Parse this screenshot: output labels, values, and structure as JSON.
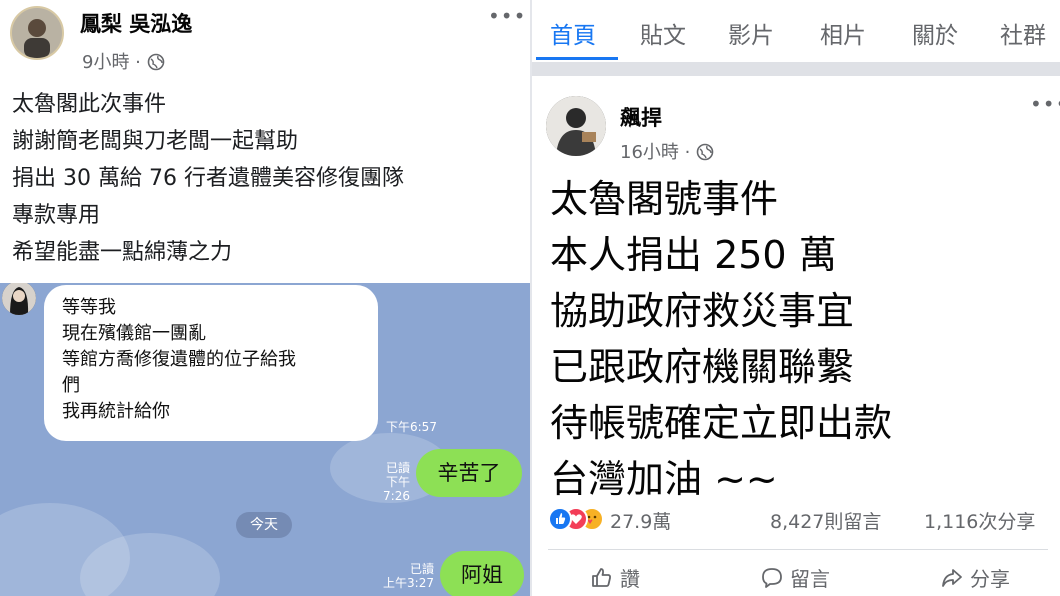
{
  "left_post": {
    "author": "鳳梨 吳泓逸",
    "time": "9小時 · ",
    "more_icon": "•••",
    "lines": [
      "太魯閣此次事件",
      "謝謝簡老闆與刀老闆一起幫助",
      "捐出 30 萬給 76 行者遺體美容修復團隊",
      "專款專用",
      "希望能盡一點綿薄之力"
    ]
  },
  "chat": {
    "incoming": {
      "lines": [
        "等等我",
        "現在殯儀館一團亂",
        "等館方喬修復遺體的位子給我",
        "們",
        "我再統計給你"
      ],
      "time": "下午6:57"
    },
    "outgoing_1": {
      "read": "已讀",
      "time": "下午7:26",
      "text": "辛苦了"
    },
    "day_separator": "今天",
    "outgoing_2": {
      "read": "已讀",
      "time": "上午3:27",
      "text": "阿姐"
    }
  },
  "right_post": {
    "tabs": [
      "首頁",
      "貼文",
      "影片",
      "相片",
      "關於",
      "社群"
    ],
    "active_tab": "首頁",
    "author": "飆捍",
    "time": "16小時 · ",
    "more_icon": "•••",
    "lines": [
      "太魯閣號事件",
      "本人捐出 250 萬",
      "協助政府救災事宜",
      "已跟政府機關聯繫",
      "待帳號確定立即出款",
      "台灣加油 ~~"
    ],
    "reactions_count": "27.9萬",
    "comments_count": "8,427則留言",
    "shares_count": "1,116次分享",
    "actions": {
      "like": "讚",
      "comment": "留言",
      "share": "分享"
    }
  },
  "colors": {
    "accent": "#1877f2",
    "chat_bg": "#8ca6d2",
    "bubble_out": "#8de055",
    "muted": "#65676b"
  }
}
